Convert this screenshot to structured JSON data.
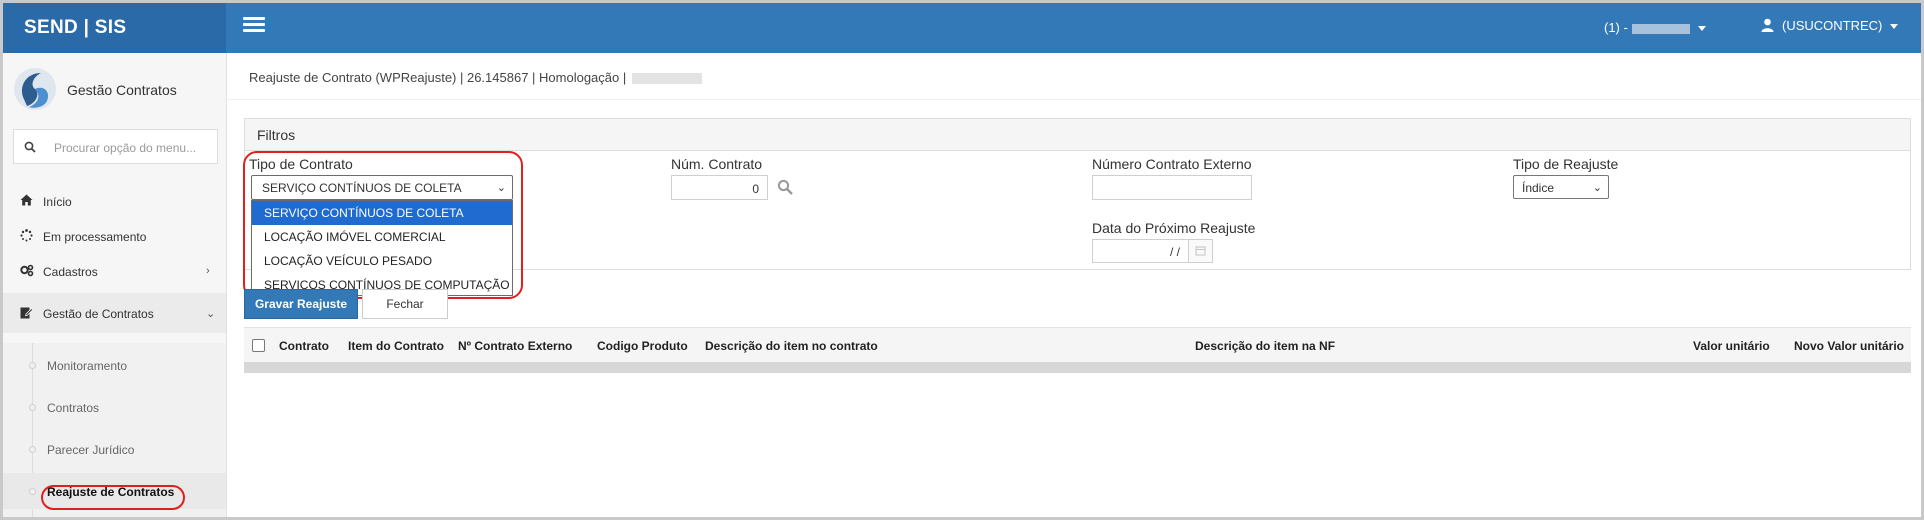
{
  "app": {
    "brand": "SEND | SIS"
  },
  "topbar": {
    "environment_prefix": "(1) -",
    "user": "(USUCONTREC)"
  },
  "sidebar": {
    "title": "Gestão Contratos",
    "search_placeholder": "Procurar opção do menu...",
    "items": [
      {
        "label": "Início",
        "icon": "home-icon"
      },
      {
        "label": "Em processamento",
        "icon": "spinner-icon"
      },
      {
        "label": "Cadastros",
        "icon": "gears-icon"
      },
      {
        "label": "Gestão de Contratos",
        "icon": "edit-icon"
      }
    ],
    "submenu": [
      {
        "label": "Monitoramento"
      },
      {
        "label": "Contratos"
      },
      {
        "label": "Parecer Jurídico"
      },
      {
        "label": "Reajuste de Contratos"
      }
    ]
  },
  "breadcrumb": "Reajuste de Contrato (WPReajuste) | 26.145867 | Homologação |",
  "filters": {
    "title": "Filtros",
    "tipo_contrato": {
      "label": "Tipo de Contrato",
      "value": "SERVIÇO CONTÍNUOS DE COLETA",
      "options": [
        "SERVIÇO CONTÍNUOS DE COLETA",
        "LOCAÇÃO IMÓVEL COMERCIAL",
        "LOCAÇÃO VEÍCULO PESADO",
        "SERVIÇOS CONTÍNUOS DE COMPUTAÇÃO"
      ]
    },
    "num_contrato": {
      "label": "Núm. Contrato",
      "value": "0"
    },
    "num_contrato_externo": {
      "label": "Número Contrato Externo",
      "value": ""
    },
    "tipo_reajuste": {
      "label": "Tipo de Reajuste",
      "value": "Índice"
    },
    "data_proximo_reajuste": {
      "label": "Data do Próximo Reajuste",
      "value": "/ /"
    }
  },
  "actions": {
    "save_label": "Gravar Reajuste",
    "close_label": "Fechar"
  },
  "table": {
    "columns": [
      "Contrato",
      "Item do Contrato",
      "Nº Contrato Externo",
      "Codigo Produto",
      "Descrição do item no contrato",
      "Descrição do item na NF",
      "Valor unitário",
      "Novo Valor unitário"
    ]
  },
  "colors": {
    "topbar": "#3379b7",
    "brand_bg": "#2b6aa8",
    "highlight": "#e02020",
    "dropdown_selected": "#1f6bd0"
  }
}
